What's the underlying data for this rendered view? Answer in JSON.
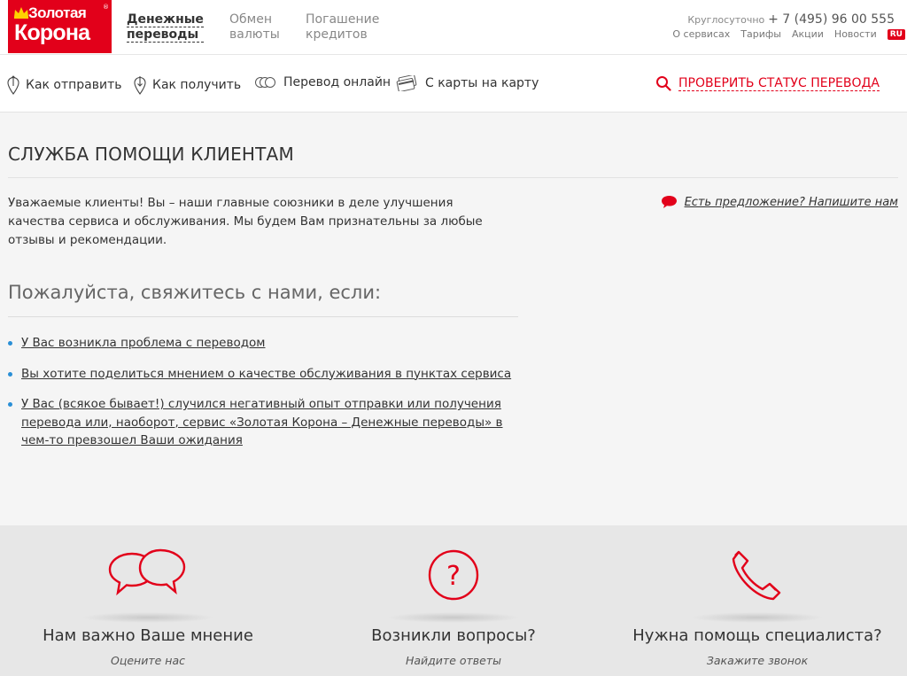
{
  "header": {
    "logo_line1": "Золотая",
    "logo_line2": "Корона",
    "logo_reg": "®",
    "nav": [
      {
        "line1": "Денежные",
        "line2": "переводы"
      },
      {
        "line1": "Обмен",
        "line2": "валюты"
      },
      {
        "line1": "Погашение",
        "line2": "кредитов"
      }
    ],
    "hotline_label": "Круглосуточно",
    "hotline_phone": "+ 7 (495) 96 00 555",
    "links": [
      "О сервисах",
      "Тарифы",
      "Акции",
      "Новости"
    ],
    "lang": "RU"
  },
  "subnav": {
    "items": [
      "Как отправить",
      "Как получить",
      "Перевод онлайн",
      "С карты на карту"
    ],
    "check_status": "ПРОВЕРИТЬ СТАТУС ПЕРЕВОДА"
  },
  "main": {
    "title": "СЛУЖБА ПОМОЩИ КЛИЕНТАМ",
    "intro": "Уважаемые клиенты! Вы – наши главные союзники в деле улучшения качества сервиса и обслуживания. Мы будем Вам признательны за любые отзывы и рекомендации.",
    "suggest_link": "Есть предложение? Напишите нам",
    "contact_title": "Пожалуйста, свяжитесь с нами, если:",
    "reasons": [
      "У Вас возникла проблема с переводом",
      "Вы хотите поделиться мнением о качестве обслуживания в пунктах сервиса",
      "У Вас (всякое бывает!) случился негативный опыт отправки или получения перевода или, наоборот, сервис «Золотая Корона – Денежные переводы» в чем-то превзошел Ваши ожидания"
    ]
  },
  "features": [
    {
      "title": "Нам важно Ваше мнение",
      "subtitle": "Оцените нас",
      "icon": "speech-bubbles-icon"
    },
    {
      "title": "Возникли вопросы?",
      "subtitle": "Найдите ответы",
      "icon": "question-circle-icon"
    },
    {
      "title": "Нужна помощь специалиста?",
      "subtitle": "Закажите звонок",
      "icon": "phone-icon"
    }
  ],
  "colors": {
    "brand_red": "#e2001a",
    "bullet_blue": "#2a8fd6",
    "footer_bg": "#e7e7e7"
  }
}
